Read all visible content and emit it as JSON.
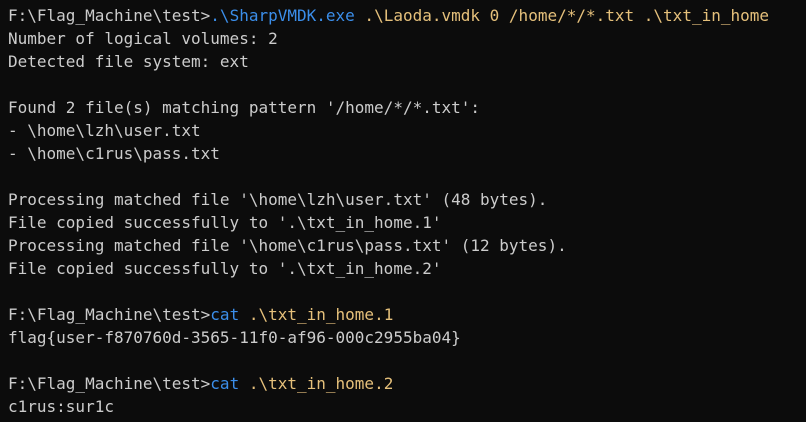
{
  "colors": {
    "background": "#0c0c0c",
    "default_text": "#cccccc",
    "command": "#3b8eea",
    "argument": "#e5c07b"
  },
  "lines": [
    [
      {
        "text": "F:\\Flag_Machine\\test>",
        "style": "default"
      },
      {
        "text": ".\\SharpVMDK.exe",
        "style": "command"
      },
      {
        "text": " .\\Laoda.vmdk 0 /home/*/*.txt .\\txt_in_home",
        "style": "arg"
      }
    ],
    [
      {
        "text": "Number of logical volumes: 2",
        "style": "default"
      }
    ],
    [
      {
        "text": "Detected file system: ext",
        "style": "default"
      }
    ],
    [],
    [
      {
        "text": "Found 2 file(s) matching pattern '/home/*/*.txt':",
        "style": "default"
      }
    ],
    [
      {
        "text": "- \\home\\lzh\\user.txt",
        "style": "default"
      }
    ],
    [
      {
        "text": "- \\home\\c1rus\\pass.txt",
        "style": "default"
      }
    ],
    [],
    [
      {
        "text": "Processing matched file '\\home\\lzh\\user.txt' (48 bytes).",
        "style": "default"
      }
    ],
    [
      {
        "text": "File copied successfully to '.\\txt_in_home.1'",
        "style": "default"
      }
    ],
    [
      {
        "text": "Processing matched file '\\home\\c1rus\\pass.txt' (12 bytes).",
        "style": "default"
      }
    ],
    [
      {
        "text": "File copied successfully to '.\\txt_in_home.2'",
        "style": "default"
      }
    ],
    [],
    [
      {
        "text": "F:\\Flag_Machine\\test>",
        "style": "default"
      },
      {
        "text": "cat",
        "style": "command"
      },
      {
        "text": " .\\txt_in_home.1",
        "style": "arg"
      }
    ],
    [
      {
        "text": "flag{user-f870760d-3565-11f0-af96-000c2955ba04}",
        "style": "default"
      }
    ],
    [],
    [
      {
        "text": "F:\\Flag_Machine\\test>",
        "style": "default"
      },
      {
        "text": "cat",
        "style": "command"
      },
      {
        "text": " .\\txt_in_home.2",
        "style": "arg"
      }
    ],
    [
      {
        "text": "c1rus:sur1c",
        "style": "default"
      }
    ]
  ]
}
